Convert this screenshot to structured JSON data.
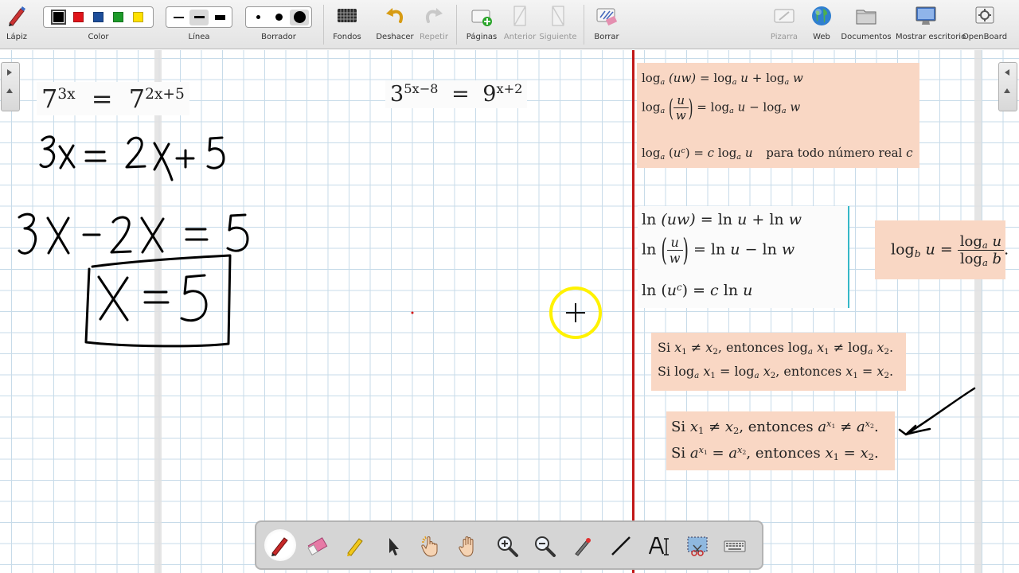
{
  "toolbar": {
    "pen_label": "Lápiz",
    "color_label": "Color",
    "line_label": "Línea",
    "eraser_label": "Borrador",
    "backgrounds_label": "Fondos",
    "undo_label": "Deshacer",
    "redo_label": "Repetir",
    "pages_label": "Páginas",
    "previous_label": "Anterior",
    "next_label": "Siguiente",
    "clear_label": "Borrar",
    "board_label": "Pizarra",
    "web_label": "Web",
    "documents_label": "Documentos",
    "desktop_label": "Mostrar escritorio",
    "openboard_label": "OpenBoard",
    "colors": [
      "#000000",
      "#e0141a",
      "#1d4e9a",
      "#1d9a2a",
      "#ffe100"
    ]
  },
  "board": {
    "red_line_color": "#c11818",
    "problem1": {
      "lhs_base": "7",
      "lhs_exp": "3x",
      "rhs_base": "7",
      "rhs_exp": "2x+5"
    },
    "problem2": {
      "lhs_base": "3",
      "lhs_exp": "5x−8",
      "rhs_base": "9",
      "rhs_exp": "x+2"
    },
    "handwriting": {
      "step1": "3x = 2x+5",
      "step2": "3x − 2x = 5",
      "answer": "x = 5"
    },
    "log_rules": {
      "log": "log",
      "a": "a",
      "u": "u",
      "w": "w",
      "c": "c",
      "product_lhs": "(uw)",
      "quotient_mid": "−",
      "power_text": "para todo número real",
      "eq": "=",
      "plus": "+"
    },
    "ln_rules": {
      "ln": "ln",
      "u": "u",
      "w": "w",
      "c": "c",
      "uw": "(uw)"
    },
    "change_of_base": {
      "log": "log",
      "b": "b",
      "a": "a",
      "u": "u"
    },
    "log_injective": {
      "si": "Si",
      "entonces": "entonces",
      "x1": "x",
      "x2": "x",
      "one": "1",
      "two": "2",
      "log": "log",
      "a": "a"
    },
    "exp_injective": {
      "si": "Si",
      "entonces": "entonces",
      "x": "x",
      "a": "a",
      "one": "1",
      "two": "2"
    }
  },
  "dock": {
    "tools": [
      "pen-tool",
      "eraser-tool",
      "highlighter-tool",
      "selector-tool",
      "interact-tool",
      "hand-tool",
      "zoom-in-tool",
      "zoom-out-tool",
      "laser-pointer-tool",
      "line-tool",
      "text-tool",
      "capture-tool",
      "virtual-keyboard-tool"
    ]
  }
}
